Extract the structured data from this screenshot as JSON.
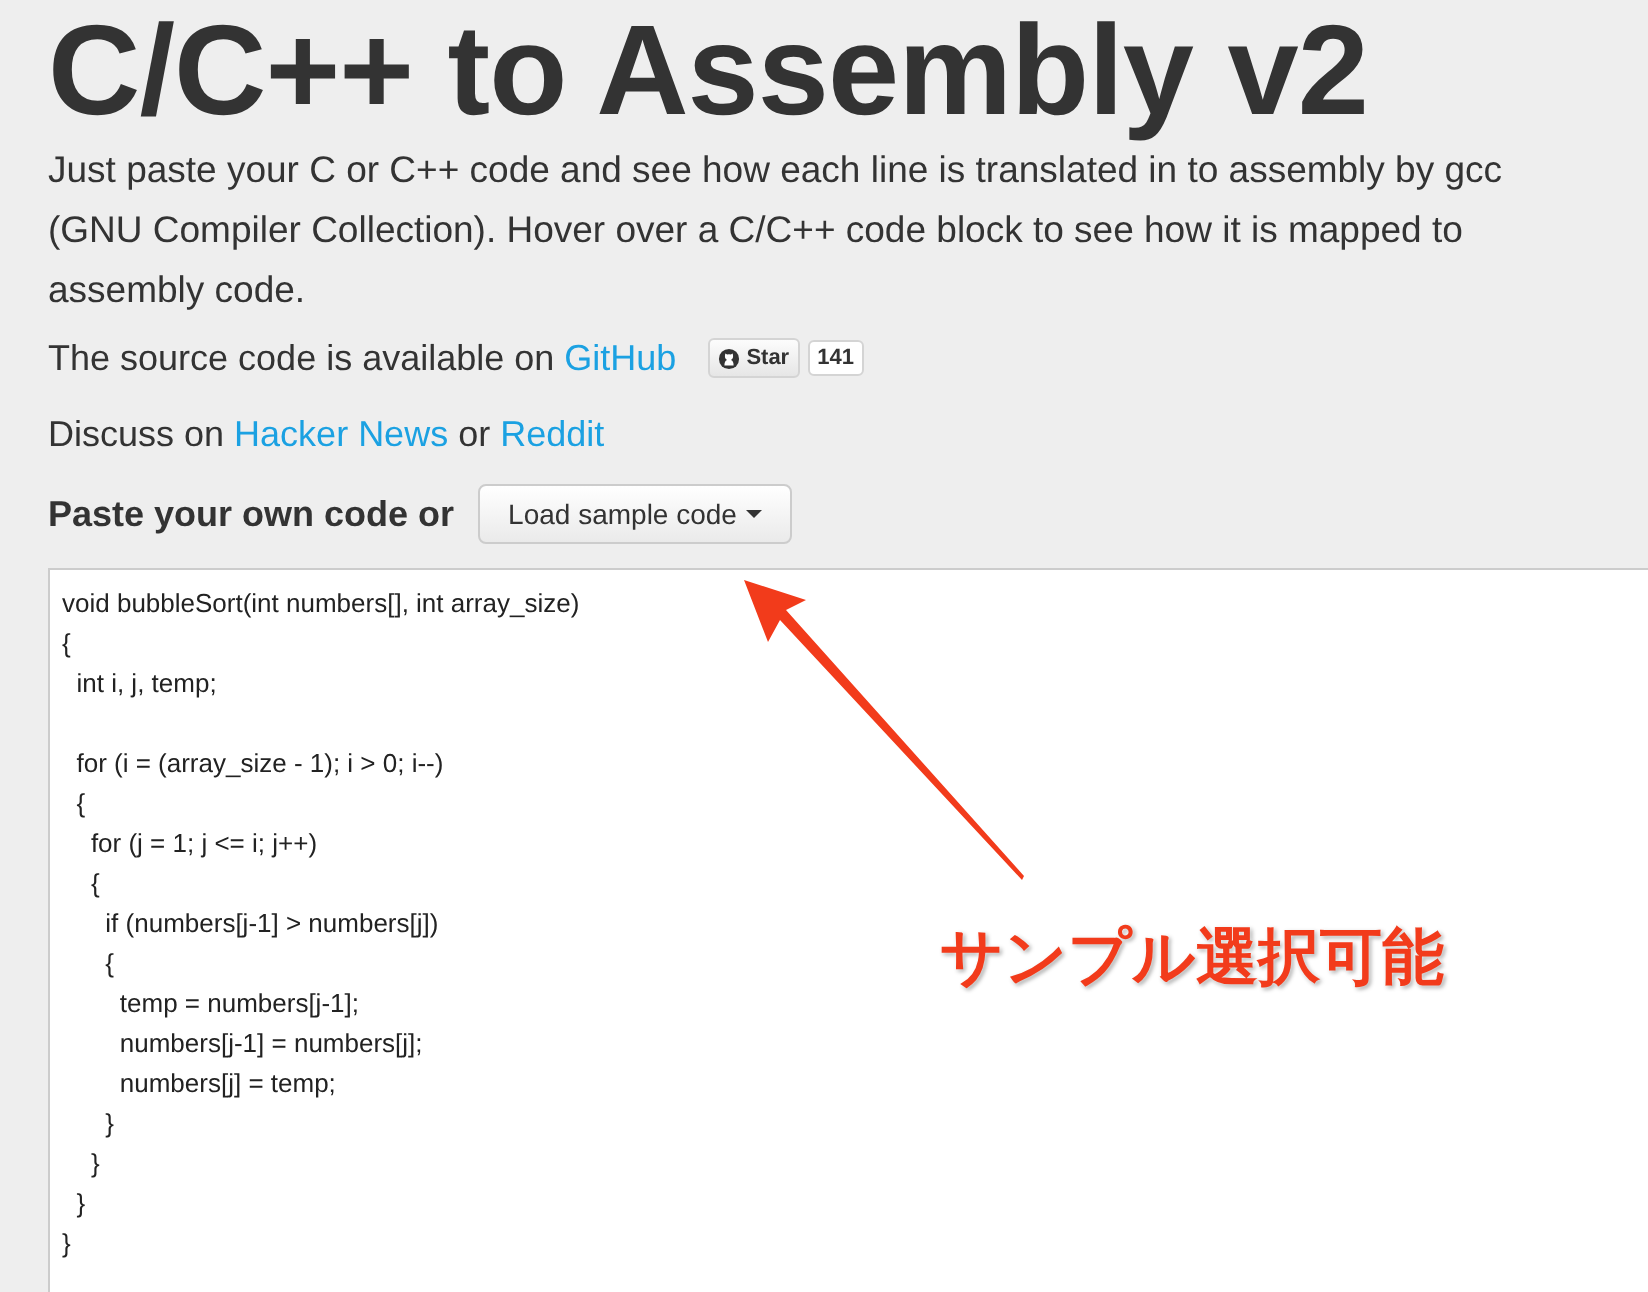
{
  "title": "C/C++ to Assembly v2",
  "intro": "Just paste your C or C++ code and see how each line is translated in to assembly by gcc (GNU Compiler Collection). Hover over a C/C++ code block to see how it is mapped to assembly code.",
  "source": {
    "text": "The source code is available on",
    "link": "GitHub",
    "star_button": "Star",
    "star_count": "141"
  },
  "discuss": {
    "prefix": "Discuss on",
    "link_1": "Hacker News",
    "middle": "or",
    "link_2": "Reddit"
  },
  "paste_label": "Paste your own code or",
  "load_button": "Load sample code",
  "code_blocks": [
    [
      "void bubbleSort(int numbers[], int array_size)",
      "{",
      "  int i, j, temp;"
    ],
    [
      "  for (i = (array_size - 1); i > 0; i--)",
      "  {",
      "    for (j = 1; j <= i; j++)",
      "    {",
      "      if (numbers[j-1] > numbers[j])",
      "      {",
      "        temp = numbers[j-1];",
      "        numbers[j-1] = numbers[j];",
      "        numbers[j] = temp;",
      "      }",
      "    }",
      "  }",
      "}"
    ]
  ],
  "annotation": "サンプル選択可能"
}
